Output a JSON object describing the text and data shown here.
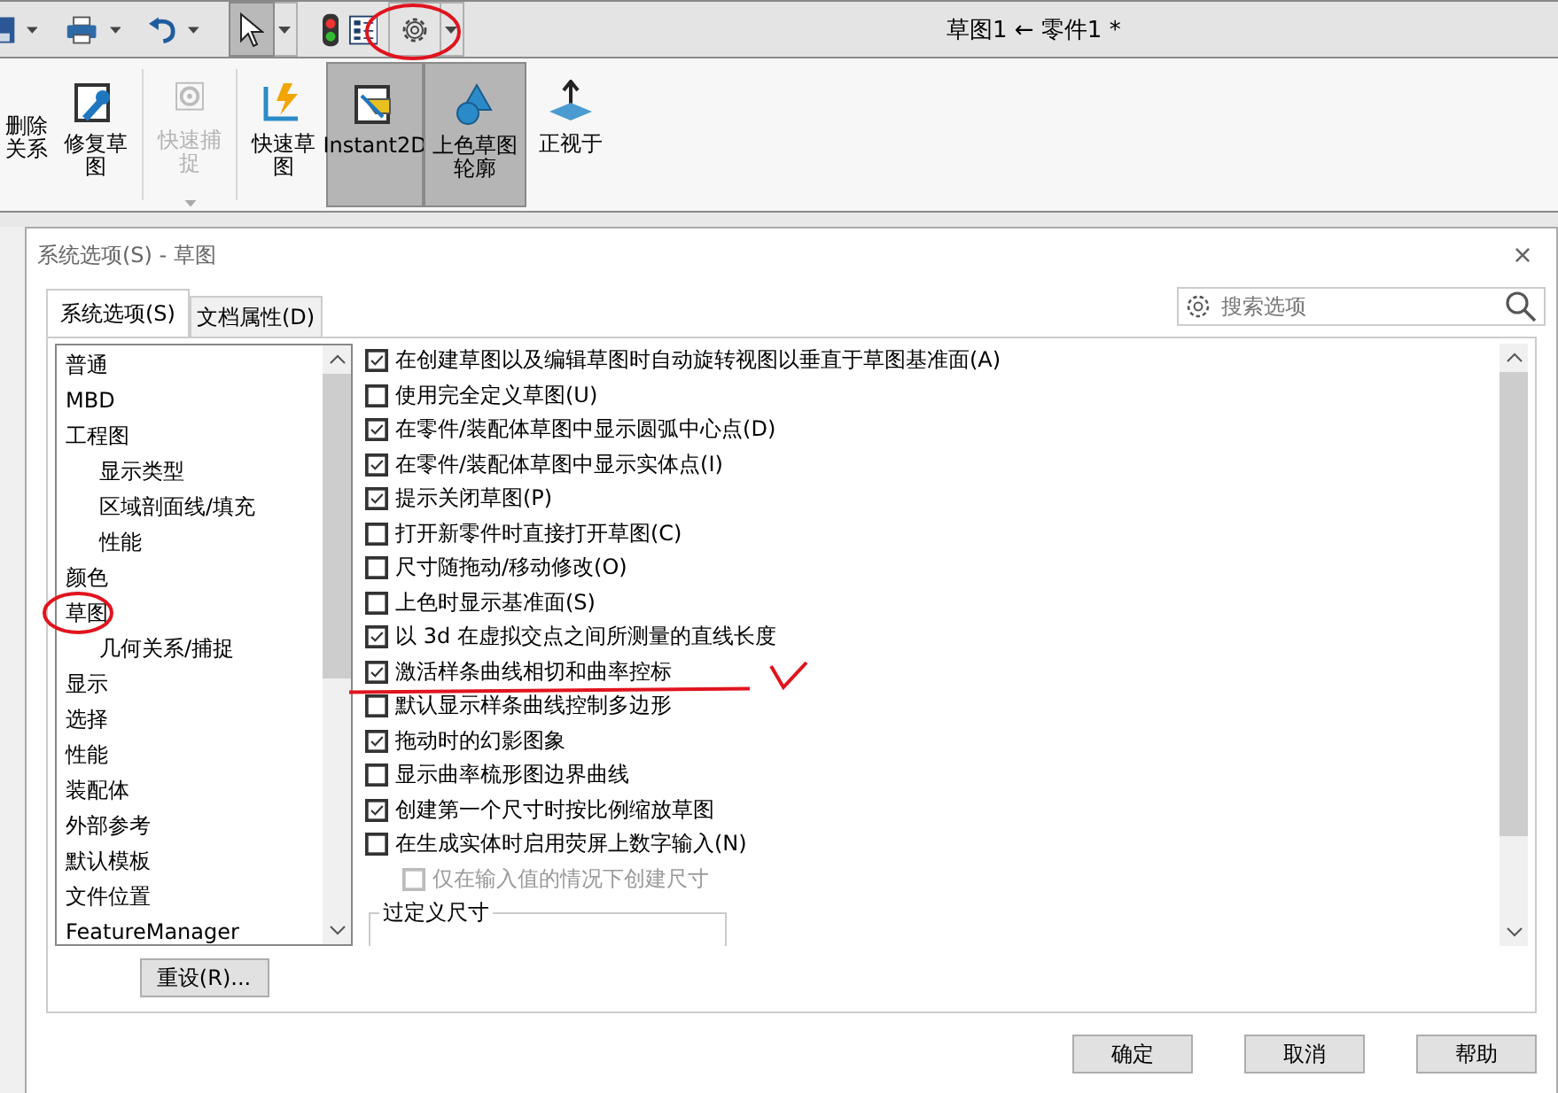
{
  "window": {
    "title": "草图1 ← 零件1 *"
  },
  "ribbon": [
    {
      "kind": "cut",
      "label": "删除关系",
      "pressed": false,
      "disabled": false
    },
    {
      "kind": "wrench",
      "label": "修复草图",
      "pressed": false,
      "disabled": false
    },
    {
      "kind": "snap",
      "label": "快速捕捉",
      "pressed": false,
      "disabled": true
    },
    {
      "kind": "quick",
      "label": "快速草图",
      "pressed": false,
      "disabled": false
    },
    {
      "kind": "instant",
      "label": "Instant2D",
      "pressed": true,
      "disabled": false
    },
    {
      "kind": "shade",
      "label": "上色草图轮廓",
      "pressed": true,
      "disabled": false
    },
    {
      "kind": "normal",
      "label": "正视于",
      "pressed": false,
      "disabled": false
    }
  ],
  "dialog": {
    "title": "系统选项(S) - 草图",
    "close": "×",
    "tabs": [
      {
        "label": "系统选项(S)",
        "selected": true
      },
      {
        "label": "文档属性(D)",
        "selected": false
      }
    ],
    "search": {
      "placeholder": "搜索选项"
    },
    "tree": [
      {
        "label": "普通"
      },
      {
        "label": "MBD"
      },
      {
        "label": "工程图",
        "children": [
          {
            "label": "显示类型"
          },
          {
            "label": "区域剖面线/填充"
          },
          {
            "label": "性能"
          }
        ]
      },
      {
        "label": "颜色"
      },
      {
        "label": "草图",
        "children": [
          {
            "label": "几何关系/捕捉"
          }
        ]
      },
      {
        "label": "显示"
      },
      {
        "label": "选择"
      },
      {
        "label": "性能"
      },
      {
        "label": "装配体"
      },
      {
        "label": "外部参考"
      },
      {
        "label": "默认模板"
      },
      {
        "label": "文件位置"
      },
      {
        "label": "FeatureManager"
      }
    ],
    "reset_button": "重设(R)...",
    "options": [
      {
        "label": "在创建草图以及编辑草图时自动旋转视图以垂直于草图基准面(A)",
        "checked": true,
        "disabled": false
      },
      {
        "label": "使用完全定义草图(U)",
        "checked": false,
        "disabled": false
      },
      {
        "label": "在零件/装配体草图中显示圆弧中心点(D)",
        "checked": true,
        "disabled": false
      },
      {
        "label": "在零件/装配体草图中显示实体点(I)",
        "checked": true,
        "disabled": false
      },
      {
        "label": "提示关闭草图(P)",
        "checked": true,
        "disabled": false
      },
      {
        "label": "打开新零件时直接打开草图(C)",
        "checked": false,
        "disabled": false
      },
      {
        "label": "尺寸随拖动/移动修改(O)",
        "checked": false,
        "disabled": false
      },
      {
        "label": "上色时显示基准面(S)",
        "checked": false,
        "disabled": false
      },
      {
        "label": "以 3d 在虚拟交点之间所测量的直线长度",
        "checked": true,
        "disabled": false
      },
      {
        "label": "激活样条曲线相切和曲率控标",
        "checked": true,
        "disabled": false
      },
      {
        "label": "默认显示样条曲线控制多边形",
        "checked": false,
        "disabled": false
      },
      {
        "label": "拖动时的幻影图象",
        "checked": true,
        "disabled": false
      },
      {
        "label": "显示曲率梳形图边界曲线",
        "checked": false,
        "disabled": false
      },
      {
        "label": "创建第一个尺寸时按比例缩放草图",
        "checked": true,
        "disabled": false
      },
      {
        "label": "在生成实体时启用荧屏上数字输入(N)",
        "checked": false,
        "disabled": false,
        "children": [
          {
            "label": "仅在输入值的情况下创建尺寸",
            "checked": false,
            "disabled": true
          }
        ]
      }
    ],
    "group_title": "过定义尺寸",
    "buttons": [
      "确定",
      "取消",
      "帮助"
    ]
  }
}
